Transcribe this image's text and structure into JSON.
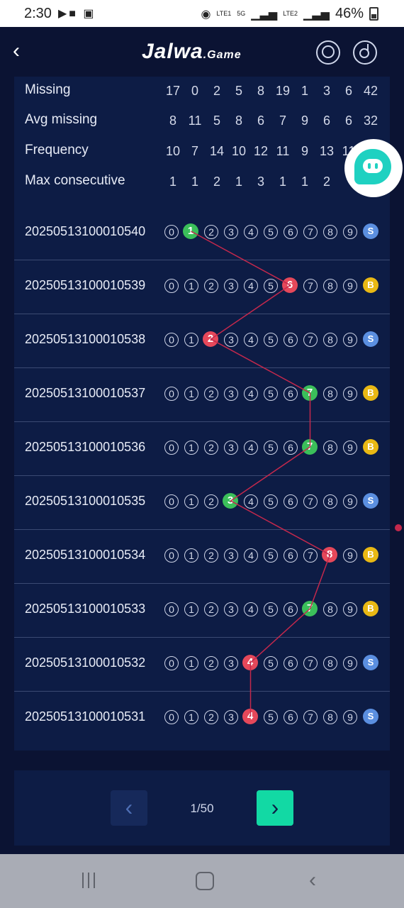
{
  "status_bar": {
    "time": "2:30",
    "battery": "46%",
    "net1": "LTE1",
    "net2": "LTE2",
    "net5g": "5G"
  },
  "header": {
    "logo": "Jalwa",
    "logo_suffix": ".Game"
  },
  "stats": {
    "rows": [
      {
        "label": "Missing",
        "values": [
          "17",
          "0",
          "2",
          "5",
          "8",
          "19",
          "1",
          "3",
          "6",
          "42"
        ]
      },
      {
        "label": "Avg missing",
        "values": [
          "8",
          "11",
          "5",
          "8",
          "6",
          "7",
          "9",
          "6",
          "6",
          "32"
        ]
      },
      {
        "label": "Frequency",
        "values": [
          "10",
          "7",
          "14",
          "10",
          "12",
          "11",
          "9",
          "13",
          "11",
          ""
        ]
      },
      {
        "label": "Max consecutive",
        "values": [
          "1",
          "1",
          "2",
          "1",
          "3",
          "1",
          "1",
          "2",
          "",
          ""
        ]
      }
    ]
  },
  "digits": [
    "0",
    "1",
    "2",
    "3",
    "4",
    "5",
    "6",
    "7",
    "8",
    "9"
  ],
  "draws": [
    {
      "period": "20250513100010540",
      "number": 1,
      "color": "green",
      "size": "S"
    },
    {
      "period": "20250513100010539",
      "number": 6,
      "color": "red",
      "size": "B"
    },
    {
      "period": "20250513100010538",
      "number": 2,
      "color": "red",
      "size": "S"
    },
    {
      "period": "20250513100010537",
      "number": 7,
      "color": "green",
      "size": "B"
    },
    {
      "period": "20250513100010536",
      "number": 7,
      "color": "green",
      "size": "B"
    },
    {
      "period": "20250513100010535",
      "number": 3,
      "color": "green",
      "size": "S"
    },
    {
      "period": "20250513100010534",
      "number": 8,
      "color": "red",
      "size": "B"
    },
    {
      "period": "20250513100010533",
      "number": 7,
      "color": "green",
      "size": "B"
    },
    {
      "period": "20250513100010532",
      "number": 4,
      "color": "red",
      "size": "S"
    },
    {
      "period": "20250513100010531",
      "number": 4,
      "color": "red",
      "size": "S"
    }
  ],
  "pagination": {
    "indicator": "1/50",
    "prev_icon": "chevron-left-icon",
    "next_icon": "chevron-right-icon"
  },
  "colors": {
    "accent": "#12d9a4",
    "green": "#3bbf5a",
    "red": "#e5485a",
    "small": "#5b8fe0",
    "big": "#e9b814",
    "trend_line": "#c4284c"
  }
}
